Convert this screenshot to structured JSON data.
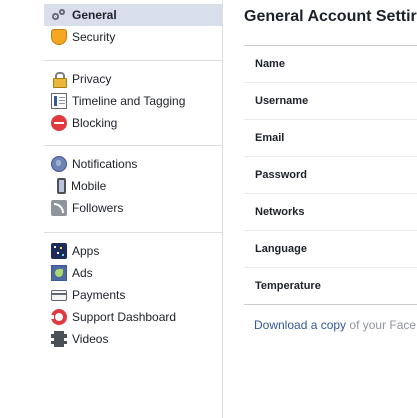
{
  "sidebar": {
    "groups": [
      {
        "items": [
          {
            "label": "General",
            "icon": "gear-icon",
            "selected": true
          },
          {
            "label": "Security",
            "icon": "shield-icon",
            "selected": false
          }
        ]
      },
      {
        "items": [
          {
            "label": "Privacy",
            "icon": "lock-icon",
            "selected": false
          },
          {
            "label": "Timeline and Tagging",
            "icon": "timeline-icon",
            "selected": false
          },
          {
            "label": "Blocking",
            "icon": "block-icon",
            "selected": false
          }
        ]
      },
      {
        "items": [
          {
            "label": "Notifications",
            "icon": "globe-icon",
            "selected": false
          },
          {
            "label": "Mobile",
            "icon": "mobile-icon",
            "selected": false
          },
          {
            "label": "Followers",
            "icon": "rss-icon",
            "selected": false
          }
        ]
      },
      {
        "items": [
          {
            "label": "Apps",
            "icon": "apps-icon",
            "selected": false
          },
          {
            "label": "Ads",
            "icon": "ads-icon",
            "selected": false
          },
          {
            "label": "Payments",
            "icon": "credit-card-icon",
            "selected": false
          },
          {
            "label": "Support Dashboard",
            "icon": "lifering-icon",
            "selected": false
          },
          {
            "label": "Videos",
            "icon": "film-icon",
            "selected": false
          }
        ]
      }
    ]
  },
  "main": {
    "title": "General Account Settir",
    "rows": [
      {
        "label": "Name"
      },
      {
        "label": "Username"
      },
      {
        "label": "Email"
      },
      {
        "label": "Password"
      },
      {
        "label": "Networks"
      },
      {
        "label": "Language"
      },
      {
        "label": "Temperature"
      }
    ],
    "download": {
      "link_text": "Download a copy",
      "suffix": " of your Face"
    }
  },
  "colors": {
    "selected_bg": "#d8dfea",
    "link": "#365899",
    "divider": "#dddfe2"
  }
}
